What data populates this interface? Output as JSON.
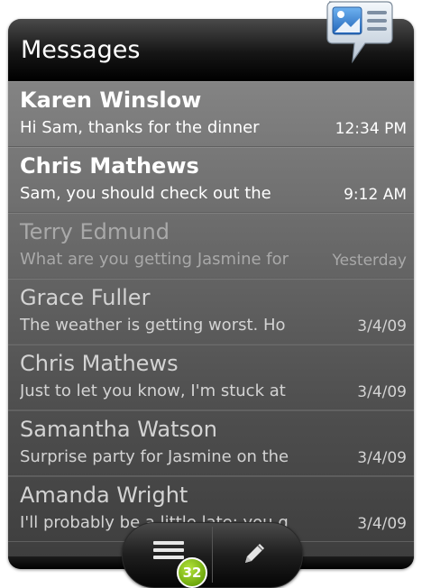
{
  "header": {
    "title": "Messages"
  },
  "messages": [
    {
      "name": "Karen Winslow",
      "preview": "Hi Sam, thanks for the dinner",
      "time": "12:34 PM",
      "state": "unread"
    },
    {
      "name": "Chris Mathews",
      "preview": "Sam, you should check out the",
      "time": "9:12 AM",
      "state": "unread"
    },
    {
      "name": "Terry Edmund",
      "preview": "What are you getting Jasmine for",
      "time": "Yesterday",
      "state": "dim"
    },
    {
      "name": "Grace Fuller",
      "preview": "The weather is getting worst. Ho",
      "time": "3/4/09",
      "state": "read"
    },
    {
      "name": "Chris Mathews",
      "preview": "Just to let you know, I'm stuck at",
      "time": "3/4/09",
      "state": "read"
    },
    {
      "name": "Samantha Watson",
      "preview": "Surprise party for Jasmine on the",
      "time": "3/4/09",
      "state": "read"
    },
    {
      "name": "Amanda Wright",
      "preview": "I'll probably be a little late; you g",
      "time": "3/4/09",
      "state": "read"
    }
  ],
  "toolbar": {
    "inbox_icon": "inbox-list-icon",
    "unread_count": "32",
    "compose_icon": "pencil-icon",
    "badge_color": "#7ab317"
  },
  "app_icon": "messaging-app-icon"
}
